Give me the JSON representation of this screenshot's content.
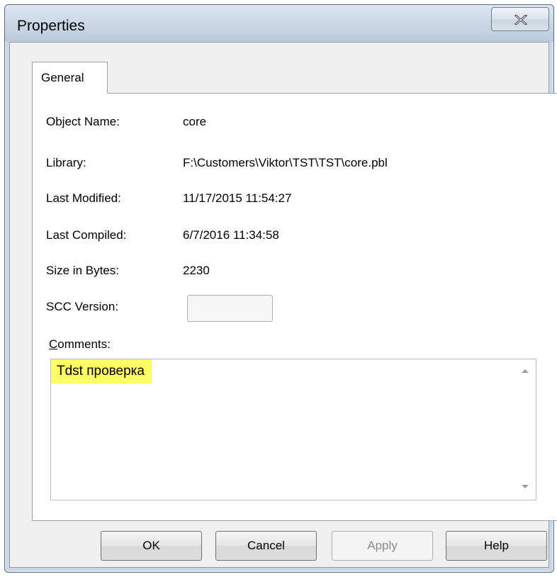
{
  "window": {
    "title": "Properties"
  },
  "tabs": [
    {
      "label": "General"
    }
  ],
  "fields": [
    {
      "label": "Object Name:",
      "value": "core"
    },
    {
      "label": "Library:",
      "value": "F:\\Customers\\Viktor\\TST\\TST\\core.pbl"
    },
    {
      "label": "Last Modified:",
      "value": "11/17/2015 11:54:27"
    },
    {
      "label": "Last Compiled:",
      "value": "6/7/2016 11:34:58"
    },
    {
      "label": "Size in Bytes:",
      "value": "2230"
    }
  ],
  "scc": {
    "label": "SCC Version:",
    "value": ""
  },
  "comments": {
    "label": "Comments:",
    "value": "Tdst проверка",
    "highlight_color": "#ffff66"
  },
  "buttons": {
    "ok": "OK",
    "cancel": "Cancel",
    "apply": "Apply",
    "help": "Help"
  },
  "icons": {
    "close": "close-icon",
    "scroll_up": "scroll-up-arrow-icon",
    "scroll_down": "scroll-down-arrow-icon"
  }
}
